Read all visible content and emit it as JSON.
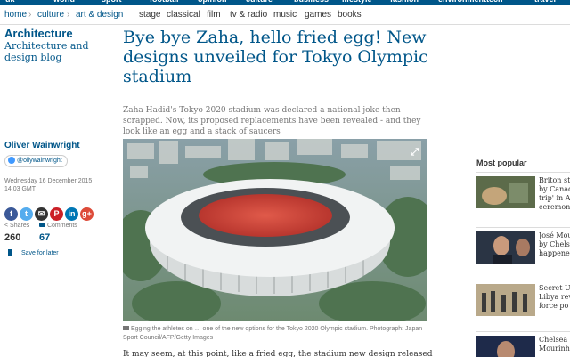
{
  "top_nav": {
    "items": [
      "uk",
      "world",
      "sport",
      "football",
      "opinion",
      "culture",
      "business",
      "lifestyle",
      "fashion",
      "environment",
      "tech",
      "travel"
    ]
  },
  "breadcrumb": {
    "home": "home",
    "culture": "culture",
    "art_design": "art & design",
    "sub_sections": [
      "stage",
      "classical",
      "film",
      "tv & radio",
      "music",
      "games",
      "books"
    ]
  },
  "section": {
    "title": "Architecture",
    "description": "Architecture and design blog"
  },
  "author": {
    "name": "Oliver Wainwright",
    "twitter": "@ollywainwright",
    "date_line1": "Wednesday 16 December 2015",
    "date_line2": "14.03 GMT"
  },
  "share": {
    "buttons": [
      {
        "icon": "facebook-icon",
        "glyph": "f",
        "color": "#3b5998"
      },
      {
        "icon": "twitter-icon",
        "glyph": "t",
        "color": "#55acee"
      },
      {
        "icon": "email-icon",
        "glyph": "✉",
        "color": "#333333"
      },
      {
        "icon": "pinterest-icon",
        "glyph": "P",
        "color": "#cb2027"
      },
      {
        "icon": "linkedin-icon",
        "glyph": "in",
        "color": "#0077b5"
      },
      {
        "icon": "googleplus-icon",
        "glyph": "g+",
        "color": "#dd4b39"
      }
    ],
    "shares_label": "Shares",
    "shares_count": "260",
    "comments_label": "Comments",
    "comments_count": "67",
    "save_label": "Save for later"
  },
  "article": {
    "headline": "Bye bye Zaha, hello fried egg! New designs unveiled for Tokyo Olympic stadium",
    "standfirst": "Zaha Hadid's Tokyo 2020 stadium was declared a national joke then scrapped. Now, its proposed replacements have been revealed - and they look like an egg and a stack of saucers",
    "caption": "Egging the athletes on … one of the new options for the Tokyo 2020 Olympic stadium. Photograph: Japan Sport Council/AFP/Getty Images",
    "body_start": "It may seem, at this point, like a fried egg, the stadium new design released this week..."
  },
  "most_popular": {
    "title": "Most popular",
    "items": [
      {
        "line1": "Briton st",
        "line2": "by Canad",
        "line3": "trip' in A",
        "line4": "ceremon"
      },
      {
        "line1": "José Mou",
        "line2": "by Chelse",
        "line3": "happene",
        "line4": ""
      },
      {
        "line1": "Secret US",
        "line2": "Libya rev",
        "line3": "force po",
        "line4": ""
      },
      {
        "line1": "Chelsea s",
        "line2": "Mourinh",
        "line3": "",
        "line4": ""
      }
    ]
  }
}
